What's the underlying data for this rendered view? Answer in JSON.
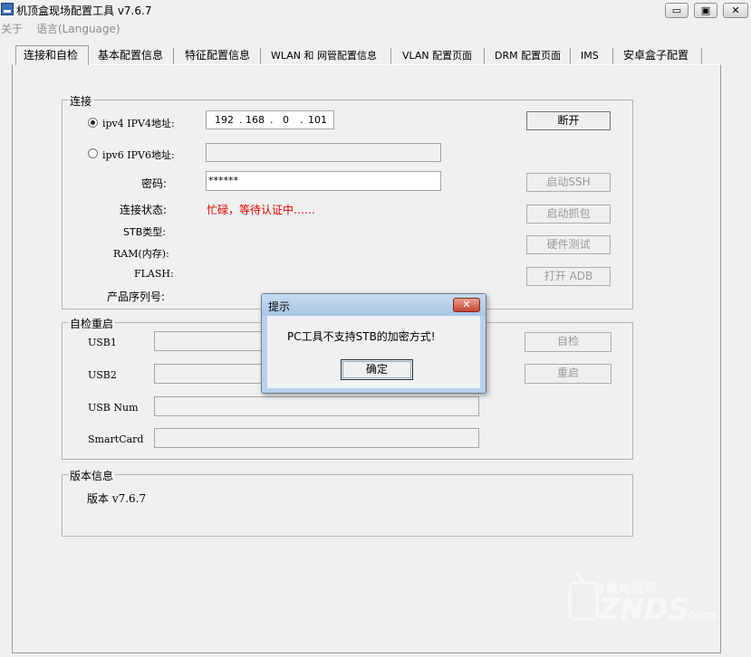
{
  "window": {
    "title": "机顶盒现场配置工具 v7.6.7",
    "minimize_glyph": "▭",
    "maximize_glyph": "▣",
    "close_glyph": "✕"
  },
  "menu": {
    "items": [
      {
        "label": "关于"
      },
      {
        "label": "语言(Language)"
      }
    ]
  },
  "tabs": [
    {
      "label": "连接和自检",
      "active": true
    },
    {
      "label": "基本配置信息"
    },
    {
      "label": "特征配置信息"
    },
    {
      "label": "WLAN 和 网管配置信息"
    },
    {
      "label": "VLAN 配置页面"
    },
    {
      "label": "DRM 配置页面"
    },
    {
      "label": "IMS"
    },
    {
      "label": "安卓盒子配置"
    }
  ],
  "connection": {
    "title": "连接",
    "ipv4_label": "ipv4  IPV4地址:",
    "ipv4_octets": [
      "192",
      "168",
      "0",
      "101"
    ],
    "ipv6_label": "ipv6  IPV6地址:",
    "ipv6_value": "",
    "password_label": "密码:",
    "password_value": "******",
    "status_label": "连接状态:",
    "status_value": "忙碌，等待认证中……",
    "status_color": "#e00000",
    "stb_type_label": "STB类型:",
    "ram_label": "RAM(内存):",
    "flash_label": "FLASH:",
    "serial_label": "产品序列号:",
    "buttons": {
      "disconnect": "断开",
      "ssh": "启动SSH",
      "capture": "启动抓包",
      "hwtest": "硬件测试",
      "adb": "打开 ADB"
    }
  },
  "selftest": {
    "title": "自检重启",
    "usb1_label": "USB1",
    "usb2_label": "USB2",
    "usbnum_label": "USB Num",
    "smartcard_label": "SmartCard",
    "check_button": "自检",
    "restart_button": "重启"
  },
  "version": {
    "title": "版本信息",
    "text": "版本 v7.6.7"
  },
  "dialog": {
    "title": "提示",
    "message": "PC工具不支持STB的加密方式!",
    "ok": "确定",
    "close_glyph": "✕"
  },
  "watermark": {
    "line1": "智能电视网",
    "line2": "ZNDS",
    "line3": ".com",
    "icon": "tv-icon",
    "color": "#ffffff"
  }
}
